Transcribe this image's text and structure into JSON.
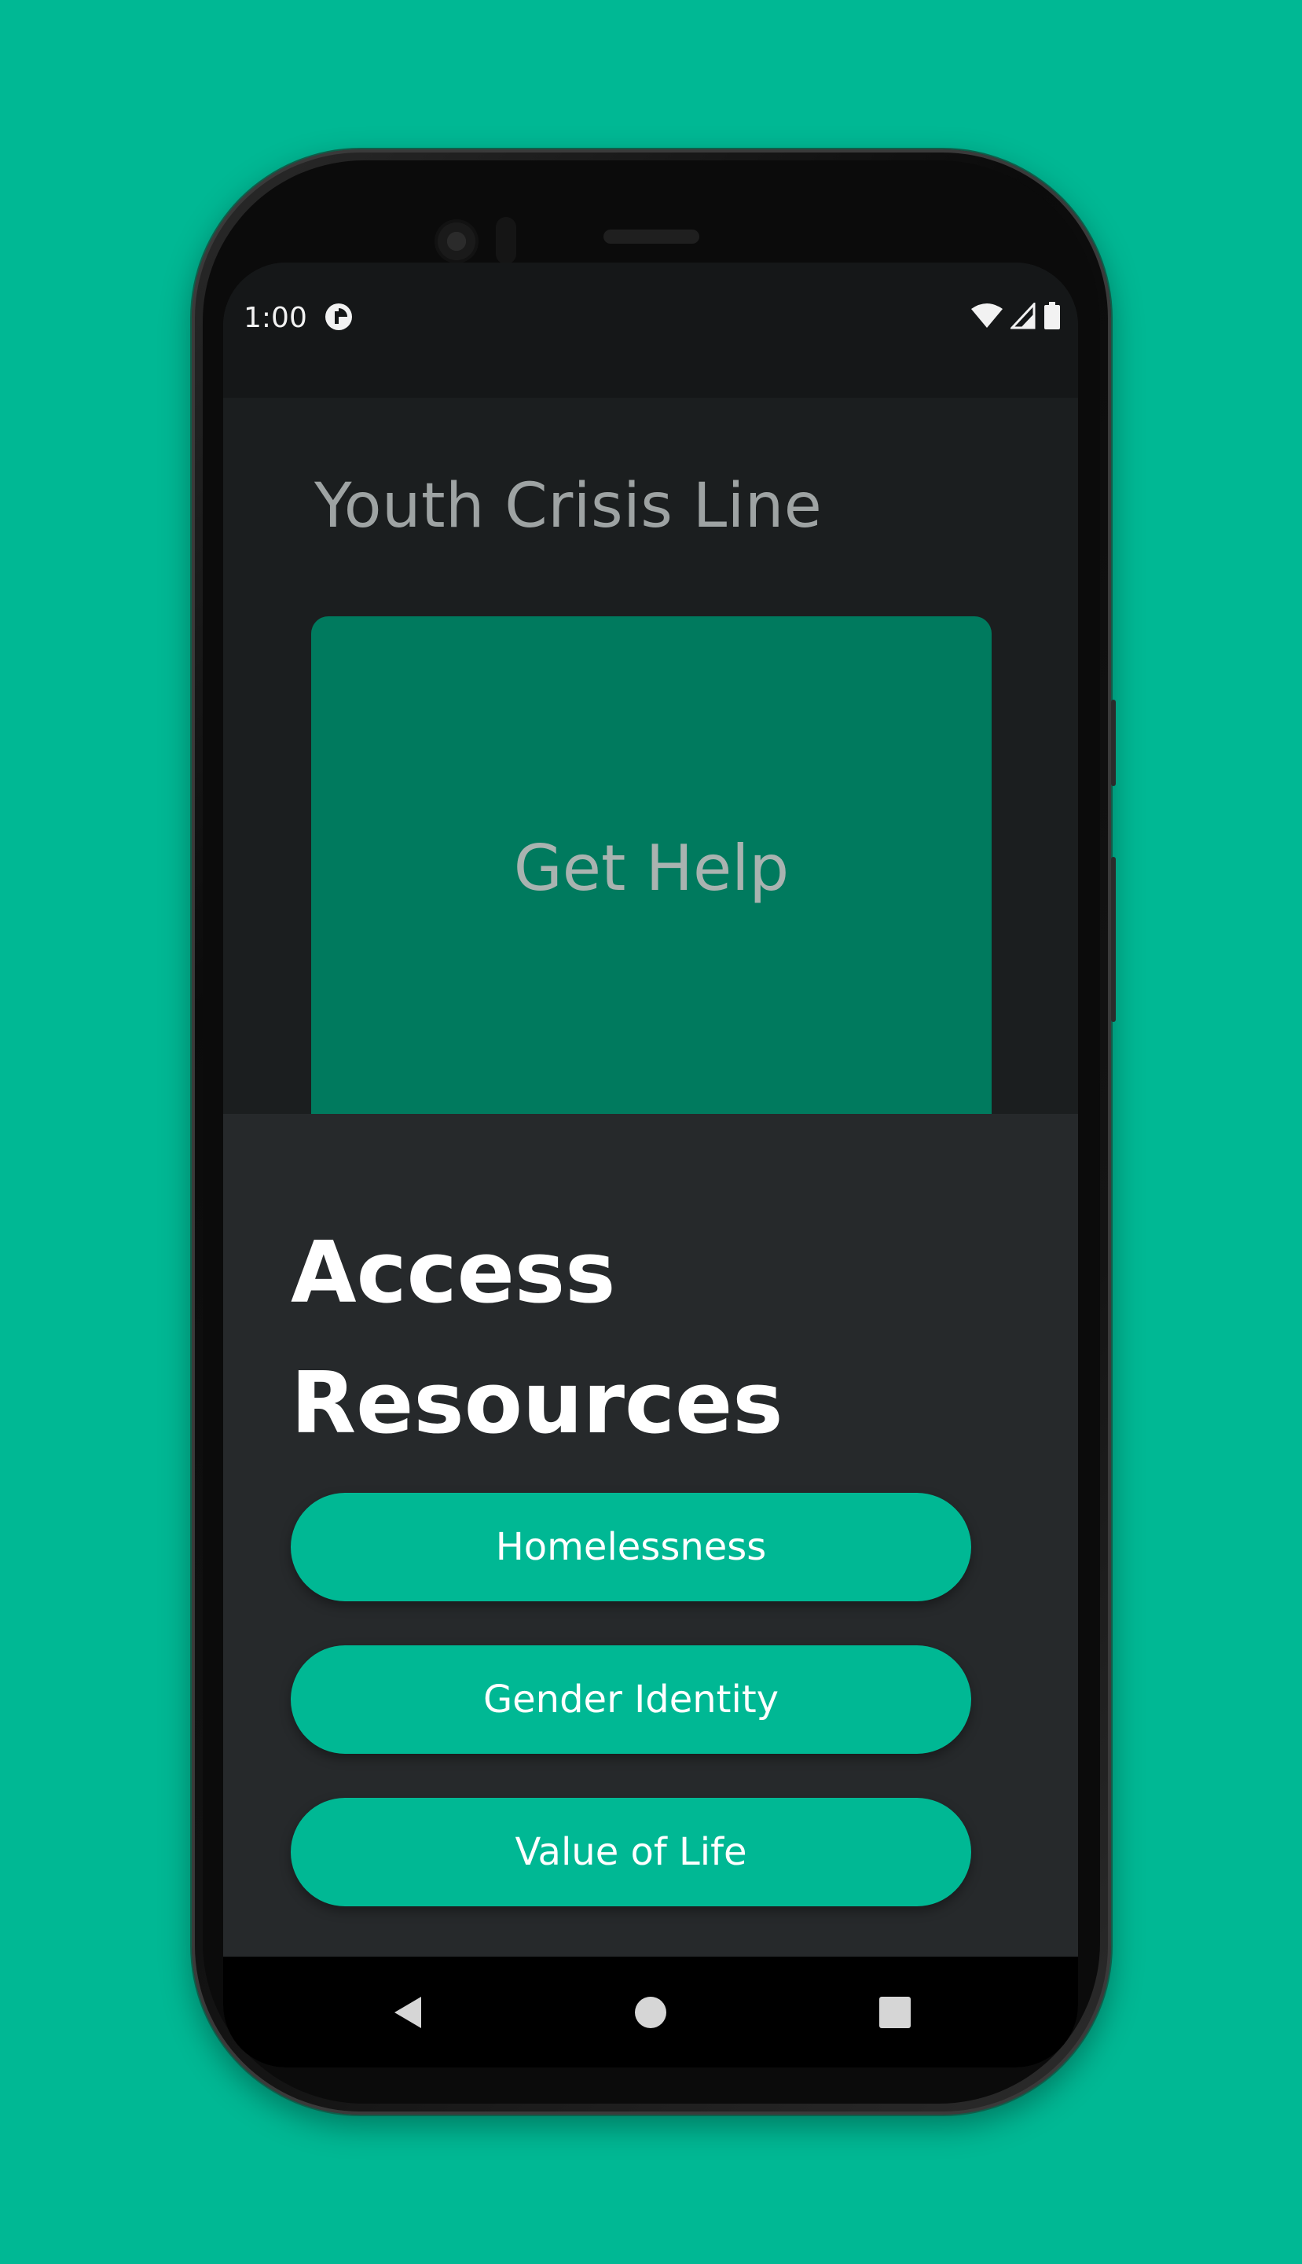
{
  "colors": {
    "background": "#00b894",
    "accent": "#00b894",
    "get_help_card": "#007a5e",
    "screen_bg": "#1b1e1f",
    "sheet_bg": "#26292b"
  },
  "status_bar": {
    "time": "1:00",
    "app_icon": "data-saver-icon",
    "icons": [
      "wifi-icon",
      "cell-signal-icon",
      "battery-icon"
    ]
  },
  "header": {
    "title": "Youth Crisis Line"
  },
  "get_help": {
    "label": "Get Help"
  },
  "resources": {
    "title_line1": "Access",
    "title_line2": "Resources",
    "buttons": [
      {
        "label": "Homelessness"
      },
      {
        "label": "Gender Identity"
      },
      {
        "label": "Value of Life"
      }
    ]
  },
  "nav_bar": {
    "icons": [
      "back-icon",
      "home-icon",
      "recents-icon"
    ]
  }
}
